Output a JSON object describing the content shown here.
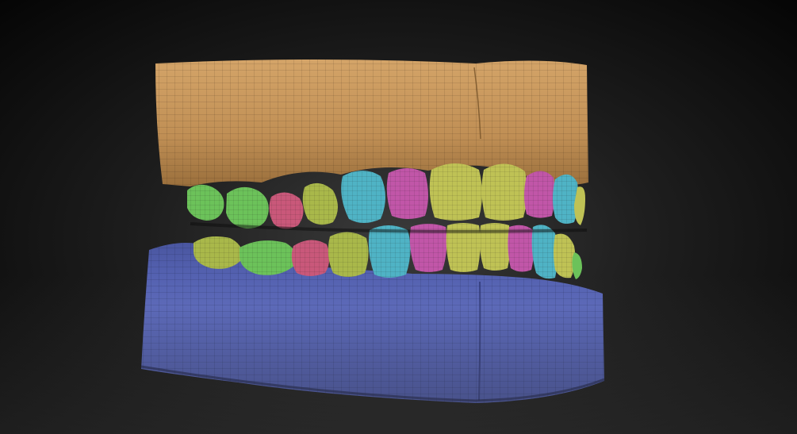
{
  "scene": {
    "subject": "dental-arch-polygroup-mesh",
    "colors": {
      "upper_gum": "#c9995f",
      "lower_gum": "#5a68b8",
      "tooth_green": "#6cc25a",
      "tooth_lime": "#a9b84a",
      "tooth_olive": "#bfc255",
      "tooth_pink": "#c95b8e",
      "tooth_red": "#c9587a",
      "tooth_cyan": "#4fb3c5",
      "tooth_magenta": "#c156a8",
      "wire_grid": "#1a1a1a"
    }
  }
}
